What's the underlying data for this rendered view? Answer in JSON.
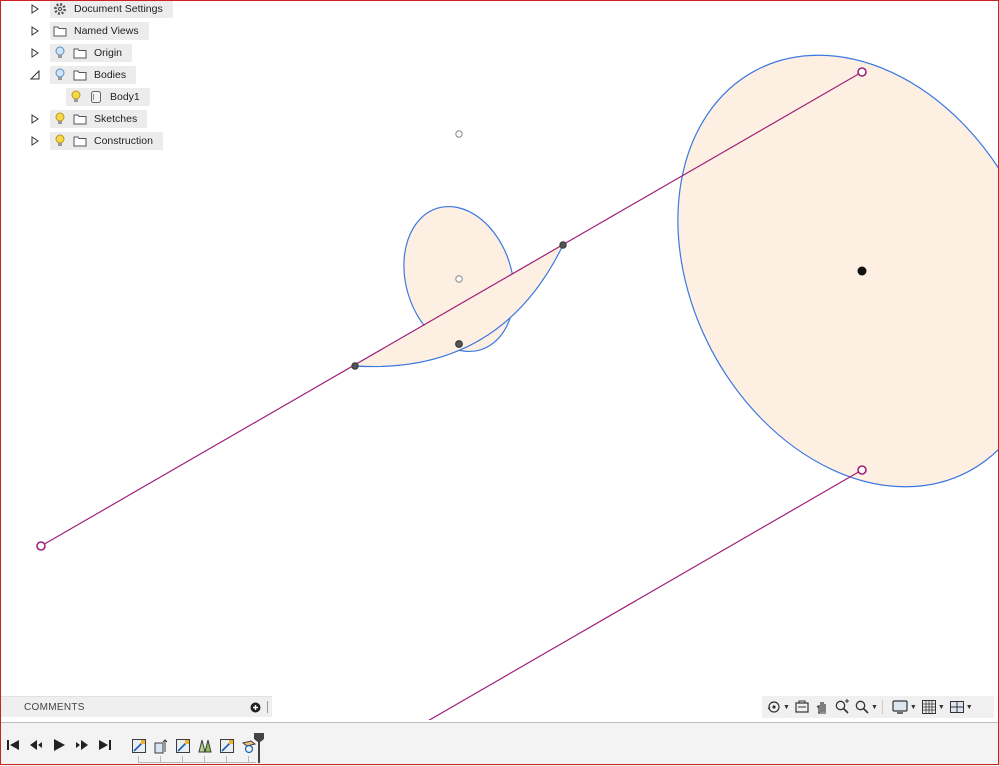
{
  "browser": {
    "items": [
      {
        "label": "Document Settings",
        "icon": "gear-icon"
      },
      {
        "label": "Named Views",
        "icon": "folder-icon"
      },
      {
        "label": "Origin",
        "icon": "folder-icon"
      },
      {
        "label": "Bodies",
        "icon": "folder-icon"
      },
      {
        "label": "Body1",
        "icon": "body-icon"
      },
      {
        "label": "Sketches",
        "icon": "folder-icon"
      },
      {
        "label": "Construction",
        "icon": "folder-icon"
      }
    ]
  },
  "comments": {
    "label": "COMMENTS"
  },
  "colors": {
    "sketch_line": "#a0207a",
    "curve": "#3b78e0",
    "profile_fill": "#fdf0e2",
    "frame": "#cc2222"
  },
  "navbar": {
    "items": [
      "orbit-icon",
      "look-at-icon",
      "pan-icon",
      "zoom-icon",
      "fit-icon",
      "display-settings-icon",
      "grid-settings-icon",
      "viewports-icon"
    ]
  },
  "timeline": {
    "playback": [
      "go-to-start-icon",
      "step-back-icon",
      "play-icon",
      "step-forward-icon",
      "go-to-end-icon"
    ],
    "features": [
      "sketch-feature-icon",
      "extrude-feature-icon",
      "sketch-feature-icon",
      "loft-feature-icon",
      "sketch-feature-icon",
      "construction-plane-icon"
    ]
  }
}
